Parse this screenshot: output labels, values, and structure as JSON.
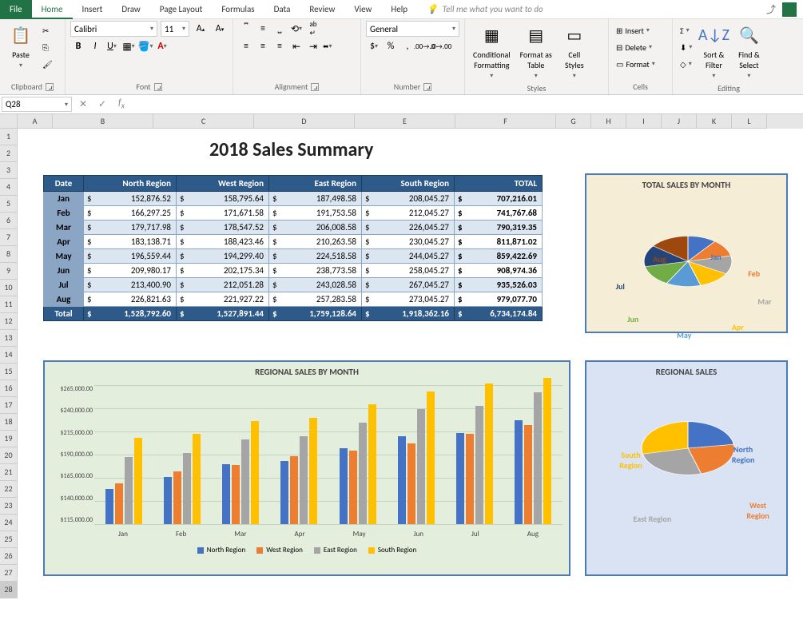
{
  "menu": {
    "file": "File",
    "home": "Home",
    "insert": "Insert",
    "draw": "Draw",
    "page_layout": "Page Layout",
    "formulas": "Formulas",
    "data": "Data",
    "review": "Review",
    "view": "View",
    "help": "Help",
    "tell": "Tell me what you want to do"
  },
  "ribbon": {
    "clipboard": {
      "label": "Clipboard",
      "paste": "Paste"
    },
    "font": {
      "label": "Font",
      "name": "Calibri",
      "size": "11"
    },
    "alignment": {
      "label": "Alignment"
    },
    "number": {
      "label": "Number",
      "format": "General"
    },
    "styles": {
      "label": "Styles",
      "cond": "Conditional\nFormatting",
      "table": "Format as\nTable",
      "cell": "Cell\nStyles"
    },
    "cells": {
      "label": "Cells",
      "insert": "Insert",
      "delete": "Delete",
      "format": "Format"
    },
    "editing": {
      "label": "Editing",
      "sort": "Sort &\nFilter",
      "find": "Find &\nSelect"
    }
  },
  "name_box": "Q28",
  "columns": [
    "A",
    "B",
    "C",
    "D",
    "E",
    "F",
    "G",
    "H",
    "I",
    "J",
    "K",
    "L"
  ],
  "rows": [
    "1",
    "2",
    "3",
    "4",
    "5",
    "6",
    "7",
    "8",
    "9",
    "10",
    "11",
    "12",
    "13",
    "14",
    "15",
    "16",
    "17",
    "18",
    "19",
    "20",
    "21",
    "22",
    "23",
    "24",
    "25",
    "26",
    "27",
    "28"
  ],
  "title": "2018 Sales Summary",
  "table": {
    "headers": [
      "Date",
      "North Region",
      "West Region",
      "East Region",
      "South Region",
      "TOTAL"
    ],
    "rows": [
      {
        "m": "Jan",
        "v": [
          "152,876.52",
          "158,795.64",
          "187,498.58",
          "208,045.27",
          "707,216.01"
        ]
      },
      {
        "m": "Feb",
        "v": [
          "166,297.25",
          "171,671.58",
          "191,753.58",
          "212,045.27",
          "741,767.68"
        ]
      },
      {
        "m": "Mar",
        "v": [
          "179,717.98",
          "178,547.52",
          "206,008.58",
          "226,045.27",
          "790,319.35"
        ]
      },
      {
        "m": "Apr",
        "v": [
          "183,138.71",
          "188,423.46",
          "210,263.58",
          "230,045.27",
          "811,871.02"
        ]
      },
      {
        "m": "May",
        "v": [
          "196,559.44",
          "194,299.40",
          "224,518.58",
          "244,045.27",
          "859,422.69"
        ]
      },
      {
        "m": "Jun",
        "v": [
          "209,980.17",
          "202,175.34",
          "238,773.58",
          "258,045.27",
          "908,974.36"
        ]
      },
      {
        "m": "Jul",
        "v": [
          "213,400.90",
          "212,051.28",
          "243,028.58",
          "267,045.27",
          "935,526.03"
        ]
      },
      {
        "m": "Aug",
        "v": [
          "226,821.63",
          "221,927.22",
          "257,283.58",
          "273,045.27",
          "979,077.70"
        ]
      }
    ],
    "total": {
      "m": "Total",
      "v": [
        "1,528,792.60",
        "1,527,891.44",
        "1,759,128.64",
        "1,918,362.16",
        "6,734,174.84"
      ]
    }
  },
  "chart_data": [
    {
      "type": "pie",
      "title": "TOTAL SALES BY MONTH",
      "categories": [
        "Jan",
        "Feb",
        "Mar",
        "Apr",
        "May",
        "Jun",
        "Jul",
        "Aug"
      ],
      "values": [
        707216.01,
        741767.68,
        790319.35,
        811871.02,
        859422.69,
        908974.36,
        935526.03,
        979077.7
      ],
      "colors": [
        "#4472c4",
        "#ed7d31",
        "#a5a5a5",
        "#ffc000",
        "#5b9bd5",
        "#70ad47",
        "#264478",
        "#9e480e"
      ]
    },
    {
      "type": "bar",
      "title": "REGIONAL SALES BY MONTH",
      "categories": [
        "Jan",
        "Feb",
        "Mar",
        "Apr",
        "May",
        "Jun",
        "Jul",
        "Aug"
      ],
      "series": [
        {
          "name": "North Region",
          "color": "#4472c4",
          "values": [
            152876.52,
            166297.25,
            179717.98,
            183138.71,
            196559.44,
            209980.17,
            213400.9,
            226821.63
          ]
        },
        {
          "name": "West Region",
          "color": "#ed7d31",
          "values": [
            158795.64,
            171671.58,
            178547.52,
            188423.46,
            194299.4,
            202175.34,
            212051.28,
            221927.22
          ]
        },
        {
          "name": "East Region",
          "color": "#a5a5a5",
          "values": [
            187498.58,
            191753.58,
            206008.58,
            210263.58,
            224518.58,
            238773.58,
            243028.58,
            257283.58
          ]
        },
        {
          "name": "South Region",
          "color": "#ffc000",
          "values": [
            208045.27,
            212045.27,
            226045.27,
            230045.27,
            244045.27,
            258045.27,
            267045.27,
            273045.27
          ]
        }
      ],
      "ylim": [
        115000,
        265000
      ],
      "yticks": [
        "$265,000.00",
        "$240,000.00",
        "$215,000.00",
        "$190,000.00",
        "$165,000.00",
        "$140,000.00",
        "$115,000.00"
      ]
    },
    {
      "type": "pie",
      "title": "REGIONAL SALES",
      "categories": [
        "North Region",
        "West Region",
        "East Region",
        "South Region"
      ],
      "values": [
        1528792.6,
        1527891.44,
        1759128.64,
        1918362.16
      ],
      "colors": [
        "#4472c4",
        "#ed7d31",
        "#a5a5a5",
        "#ffc000"
      ]
    }
  ]
}
